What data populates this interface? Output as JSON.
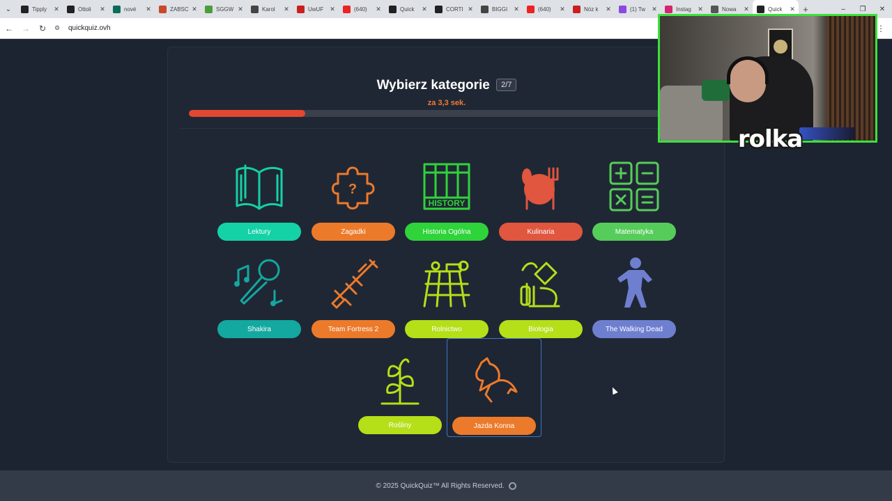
{
  "browser": {
    "tabs": [
      {
        "title": "Tipply",
        "color": "#222"
      },
      {
        "title": "Ottoli",
        "color": "#222"
      },
      {
        "title": "nové",
        "color": "#0c6c5a"
      },
      {
        "title": "ZABSC",
        "color": "#c8482a"
      },
      {
        "title": "SGGW",
        "color": "#4b9c3a"
      },
      {
        "title": "Karol",
        "color": "#444"
      },
      {
        "title": "UwUF",
        "color": "#c82020"
      },
      {
        "title": "(640)",
        "color": "#e22"
      },
      {
        "title": "Quick",
        "color": "#222"
      },
      {
        "title": "CORTI",
        "color": "#222"
      },
      {
        "title": "BIGGI",
        "color": "#444"
      },
      {
        "title": "(640)",
        "color": "#e22"
      },
      {
        "title": "Nóz k",
        "color": "#c82020"
      },
      {
        "title": "(1) Tw",
        "color": "#8a4ae0"
      },
      {
        "title": "Instag",
        "color": "#d6246e"
      },
      {
        "title": "Nowa",
        "color": "#555"
      },
      {
        "title": "Quick",
        "color": "#222",
        "active": true
      }
    ],
    "url": "quickquiz.ovh"
  },
  "quiz": {
    "title": "Wybierz kategorie",
    "round_badge": "2/7",
    "timer_text": "za 3,3 sek.",
    "progress": 0.225
  },
  "categories": [
    {
      "label": "Lektury",
      "color": "#14d1a6",
      "icon": "book-icon"
    },
    {
      "label": "Zagadki",
      "color": "#ec7a2b",
      "icon": "puzzle-icon"
    },
    {
      "label": "Historia Ogólna",
      "color": "#2fd33a",
      "icon": "history-icon"
    },
    {
      "label": "Kulinaria",
      "color": "#e0563e",
      "icon": "plate-icon"
    },
    {
      "label": "Matematyka",
      "color": "#56cc5a",
      "icon": "math-icon"
    },
    {
      "label": "Shakira",
      "color": "#13a8a0",
      "icon": "microphone-icon"
    },
    {
      "label": "Team Fortress 2",
      "color": "#ec7a2b",
      "icon": "gun-icon"
    },
    {
      "label": "Rolnictwo",
      "color": "#b5df18",
      "icon": "tractor-icon"
    },
    {
      "label": "Biologia",
      "color": "#b5df18",
      "icon": "microscope-icon"
    },
    {
      "label": "The Walking Dead",
      "color": "#6f7fd0",
      "icon": "zombie-icon"
    },
    {
      "label": "Rośliny",
      "color": "#b5df18",
      "icon": "plant-icon"
    },
    {
      "label": "Jazda Konna",
      "color": "#ec7a2b",
      "icon": "horse-icon",
      "selected": true
    }
  ],
  "footer": {
    "text": "© 2025  QuickQuiz™ All Rights Reserved."
  },
  "stream": {
    "caption": "rolka",
    "border_color": "#3be23b"
  }
}
